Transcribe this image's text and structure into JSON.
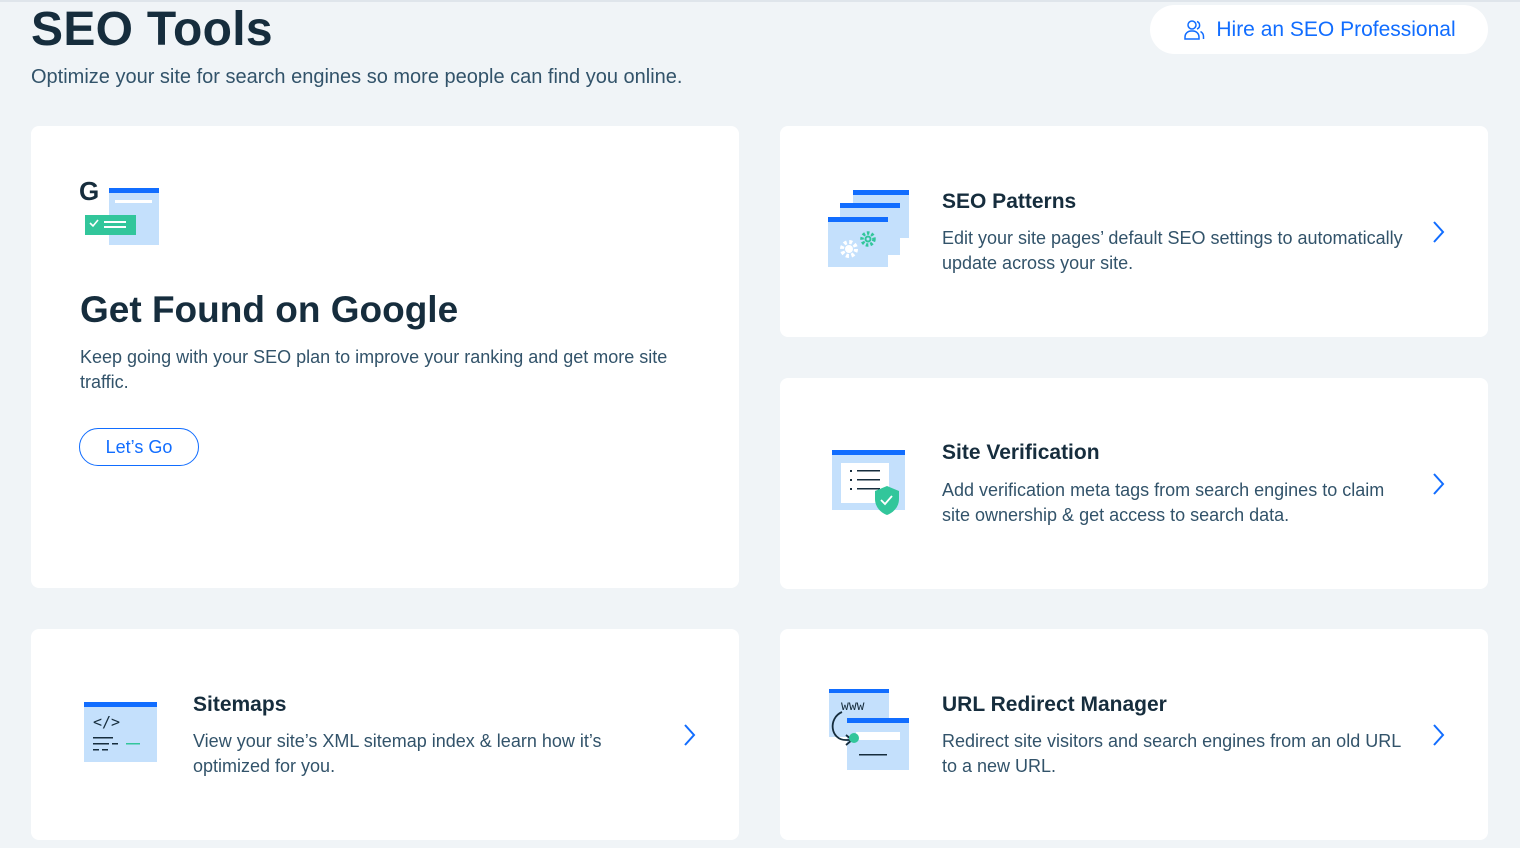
{
  "header": {
    "title": "SEO Tools",
    "subtitle": "Optimize your site for search engines so more people can find you online.",
    "hire_button_label": "Hire an SEO Professional",
    "hire_button_icon": "users-icon"
  },
  "feature_card": {
    "title": "Get Found on Google",
    "description": "Keep going with your SEO plan to improve your ranking and get more site traffic.",
    "button_label": "Let’s Go",
    "icon": "google-search-results-icon",
    "icon_letter": "G"
  },
  "cards": [
    {
      "title": "SEO Patterns",
      "description": "Edit your site pages’ default SEO settings to automatically update across your site.",
      "icon": "seo-patterns-icon"
    },
    {
      "title": "Site Verification",
      "description": "Add verification meta tags from search engines to claim site ownership & get access to search data.",
      "icon": "site-verification-icon"
    },
    {
      "title": "Sitemaps",
      "description": "View your site’s XML sitemap index & learn how it’s optimized for you.",
      "icon": "sitemap-icon",
      "icon_text": "</>"
    },
    {
      "title": "URL Redirect Manager",
      "description": "Redirect site visitors and search engines from an old URL to a new URL.",
      "icon": "url-redirect-icon",
      "icon_text": "www"
    }
  ],
  "colors": {
    "background": "#f0f4f7",
    "card": "#ffffff",
    "accent_blue": "#116dff",
    "light_blue": "#c4e0fc",
    "teal": "#32c69b",
    "text_dark": "#162d3d",
    "text_secondary": "#32536a"
  }
}
